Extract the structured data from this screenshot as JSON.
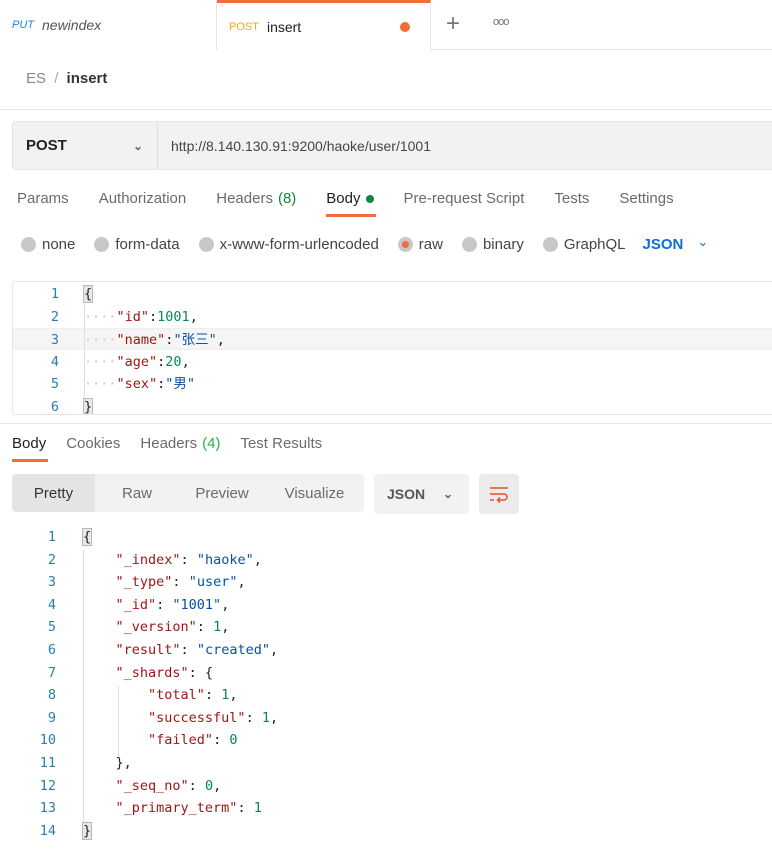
{
  "tabs": [
    {
      "method": "PUT",
      "name": "newindex",
      "method_color": "#1c84e3"
    },
    {
      "method": "POST",
      "name": "insert",
      "method_color": "#f5a623",
      "unsaved": true
    }
  ],
  "tab_actions": {
    "new_tab": "+",
    "more": "ooo"
  },
  "breadcrumb": {
    "collection": "ES",
    "separator": "/",
    "request": "insert"
  },
  "request": {
    "method": "POST",
    "url": "http://8.140.130.91:9200/haoke/user/1001"
  },
  "request_tabs": [
    {
      "label": "Params"
    },
    {
      "label": "Authorization"
    },
    {
      "label": "Headers",
      "count": "(8)"
    },
    {
      "label": "Body",
      "active": true
    },
    {
      "label": "Pre-request Script"
    },
    {
      "label": "Tests"
    },
    {
      "label": "Settings"
    }
  ],
  "body_types": [
    {
      "label": "none"
    },
    {
      "label": "form-data"
    },
    {
      "label": "x-www-form-urlencoded"
    },
    {
      "label": "raw",
      "selected": true
    },
    {
      "label": "binary"
    },
    {
      "label": "GraphQL"
    }
  ],
  "body_format": "JSON",
  "request_body": [
    [
      [
        "br",
        "{"
      ]
    ],
    [
      [
        "g",
        "····"
      ],
      [
        "k",
        "\"id\""
      ],
      [
        "p",
        ":"
      ],
      [
        "n",
        "1001"
      ],
      [
        "p",
        ","
      ]
    ],
    [
      [
        "g",
        "····"
      ],
      [
        "k",
        "\"name\""
      ],
      [
        "p",
        ":"
      ],
      [
        "s",
        "\"张三\""
      ],
      [
        "p",
        ","
      ]
    ],
    [
      [
        "g",
        "····"
      ],
      [
        "k",
        "\"age\""
      ],
      [
        "p",
        ":"
      ],
      [
        "n",
        "20"
      ],
      [
        "p",
        ","
      ]
    ],
    [
      [
        "g",
        "····"
      ],
      [
        "k",
        "\"sex\""
      ],
      [
        "p",
        ":"
      ],
      [
        "s",
        "\"男\""
      ]
    ],
    [
      [
        "br",
        "}"
      ]
    ]
  ],
  "response_tabs": [
    {
      "label": "Body",
      "active": true
    },
    {
      "label": "Cookies"
    },
    {
      "label": "Headers",
      "count": "(4)"
    },
    {
      "label": "Test Results"
    }
  ],
  "response_views": [
    "Pretty",
    "Raw",
    "Preview",
    "Visualize"
  ],
  "response_format": "JSON",
  "response_body": [
    [
      [
        "br",
        "{"
      ]
    ],
    [
      [
        "p",
        "    "
      ],
      [
        "k",
        "\"_index\""
      ],
      [
        "p",
        ": "
      ],
      [
        "s",
        "\"haoke\""
      ],
      [
        "p",
        ","
      ]
    ],
    [
      [
        "p",
        "    "
      ],
      [
        "k",
        "\"_type\""
      ],
      [
        "p",
        ": "
      ],
      [
        "s",
        "\"user\""
      ],
      [
        "p",
        ","
      ]
    ],
    [
      [
        "p",
        "    "
      ],
      [
        "k",
        "\"_id\""
      ],
      [
        "p",
        ": "
      ],
      [
        "s",
        "\"1001\""
      ],
      [
        "p",
        ","
      ]
    ],
    [
      [
        "p",
        "    "
      ],
      [
        "k",
        "\"_version\""
      ],
      [
        "p",
        ": "
      ],
      [
        "n",
        "1"
      ],
      [
        "p",
        ","
      ]
    ],
    [
      [
        "p",
        "    "
      ],
      [
        "k",
        "\"result\""
      ],
      [
        "p",
        ": "
      ],
      [
        "s",
        "\"created\""
      ],
      [
        "p",
        ","
      ]
    ],
    [
      [
        "p",
        "    "
      ],
      [
        "k",
        "\"_shards\""
      ],
      [
        "p",
        ": {"
      ]
    ],
    [
      [
        "p",
        "        "
      ],
      [
        "k",
        "\"total\""
      ],
      [
        "p",
        ": "
      ],
      [
        "n",
        "1"
      ],
      [
        "p",
        ","
      ]
    ],
    [
      [
        "p",
        "        "
      ],
      [
        "k",
        "\"successful\""
      ],
      [
        "p",
        ": "
      ],
      [
        "n",
        "1"
      ],
      [
        "p",
        ","
      ]
    ],
    [
      [
        "p",
        "        "
      ],
      [
        "k",
        "\"failed\""
      ],
      [
        "p",
        ": "
      ],
      [
        "n",
        "0"
      ]
    ],
    [
      [
        "p",
        "    },"
      ]
    ],
    [
      [
        "p",
        "    "
      ],
      [
        "k",
        "\"_seq_no\""
      ],
      [
        "p",
        ": "
      ],
      [
        "n",
        "0"
      ],
      [
        "p",
        ","
      ]
    ],
    [
      [
        "p",
        "    "
      ],
      [
        "k",
        "\"_primary_term\""
      ],
      [
        "p",
        ": "
      ],
      [
        "n",
        "1"
      ]
    ],
    [
      [
        "br",
        "}"
      ]
    ]
  ],
  "colors": {
    "accent": "#f26b3a",
    "key": "#a31515",
    "string": "#0451a5",
    "number": "#098658",
    "link": "#0d6ed6",
    "count": "#0c8a3b"
  }
}
